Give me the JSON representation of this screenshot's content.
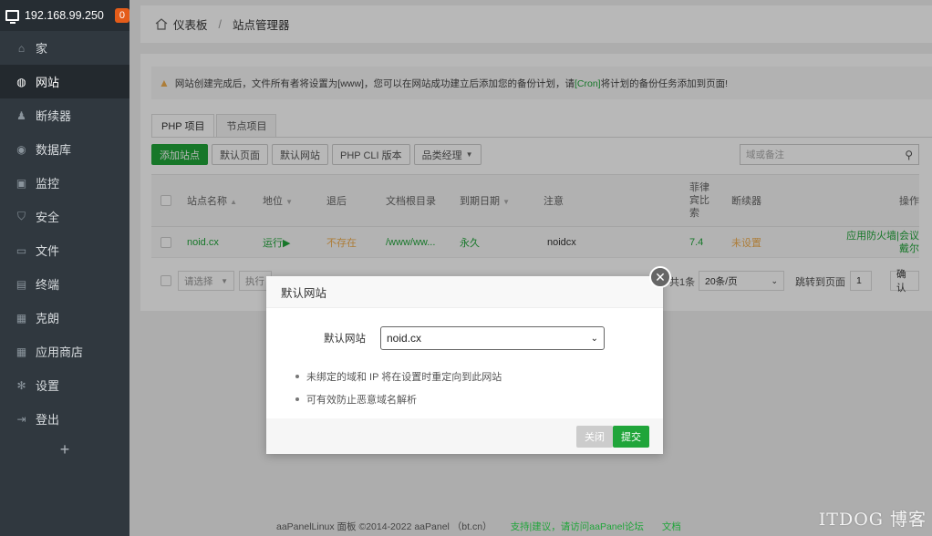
{
  "sidebar": {
    "server": "192.168.99.250",
    "badge": "0",
    "items": [
      {
        "label": "家",
        "icon": "home-icon"
      },
      {
        "label": "网站",
        "icon": "globe-icon"
      },
      {
        "label": "断续器",
        "icon": "user-icon"
      },
      {
        "label": "数据库",
        "icon": "database-icon"
      },
      {
        "label": "监控",
        "icon": "monitor-icon"
      },
      {
        "label": "安全",
        "icon": "shield-icon"
      },
      {
        "label": "文件",
        "icon": "folder-icon"
      },
      {
        "label": "终端",
        "icon": "terminal-icon"
      },
      {
        "label": "克朗",
        "icon": "calendar-icon"
      },
      {
        "label": "应用商店",
        "icon": "grid-icon"
      },
      {
        "label": "设置",
        "icon": "gear-icon"
      },
      {
        "label": "登出",
        "icon": "logout-icon"
      }
    ],
    "active_index": 1,
    "add_label": "+"
  },
  "breadcrumb": {
    "home": "仪表板",
    "sep": "/",
    "current": "站点管理器"
  },
  "alert": {
    "text_before": "网站创建完成后，文件所有者将设置为[www]，您可以在网站成功建立后添加您的备份计划，请",
    "cron": "[Cron]",
    "text_after": "将计划的备份任务添加到页面!"
  },
  "tabs": [
    "PHP 项目",
    "节点项目"
  ],
  "toolbar": {
    "add_site": "添加站点",
    "default_page": "默认页面",
    "default_site": "默认网站",
    "php_cli": "PHP CLI 版本",
    "category": "品类经理"
  },
  "search": {
    "placeholder": "域或备注"
  },
  "table": {
    "headers": {
      "name": "站点名称",
      "status": "地位",
      "backup": "退后",
      "root": "文档根目录",
      "expire": "到期日期",
      "note": "注意",
      "php": "菲律宾比索",
      "waf": "断续器",
      "op": "操作"
    },
    "row": {
      "name": "noid.cx",
      "status": "运行▶",
      "backup": "不存在",
      "root": "/www/ww...",
      "expire": "永久",
      "note": "noidcx",
      "php": "7.4",
      "waf": "未设置",
      "op": "应用防火墙|会议戴尔"
    }
  },
  "pager": {
    "select": "请选择",
    "exec": "执行",
    "total": "共1条",
    "per_page": "20条/页",
    "goto": "跳转到页面",
    "page": "1",
    "confirm": "确认"
  },
  "modal": {
    "title": "默认网站",
    "field_label": "默认网站",
    "field_value": "noid.cx",
    "tips": [
      "未绑定的域和 IP 将在设置时重定向到此网站",
      "可有效防止恶意域名解析"
    ],
    "cancel": "关闭",
    "submit": "提交"
  },
  "footer": {
    "copyright": "aaPanelLinux 面板 ©2014-2022 aaPanel （bt.cn）",
    "support": "支持|建议，请访问aaPanel论坛",
    "docs": "文档"
  },
  "watermark": "ITDOG 博客"
}
